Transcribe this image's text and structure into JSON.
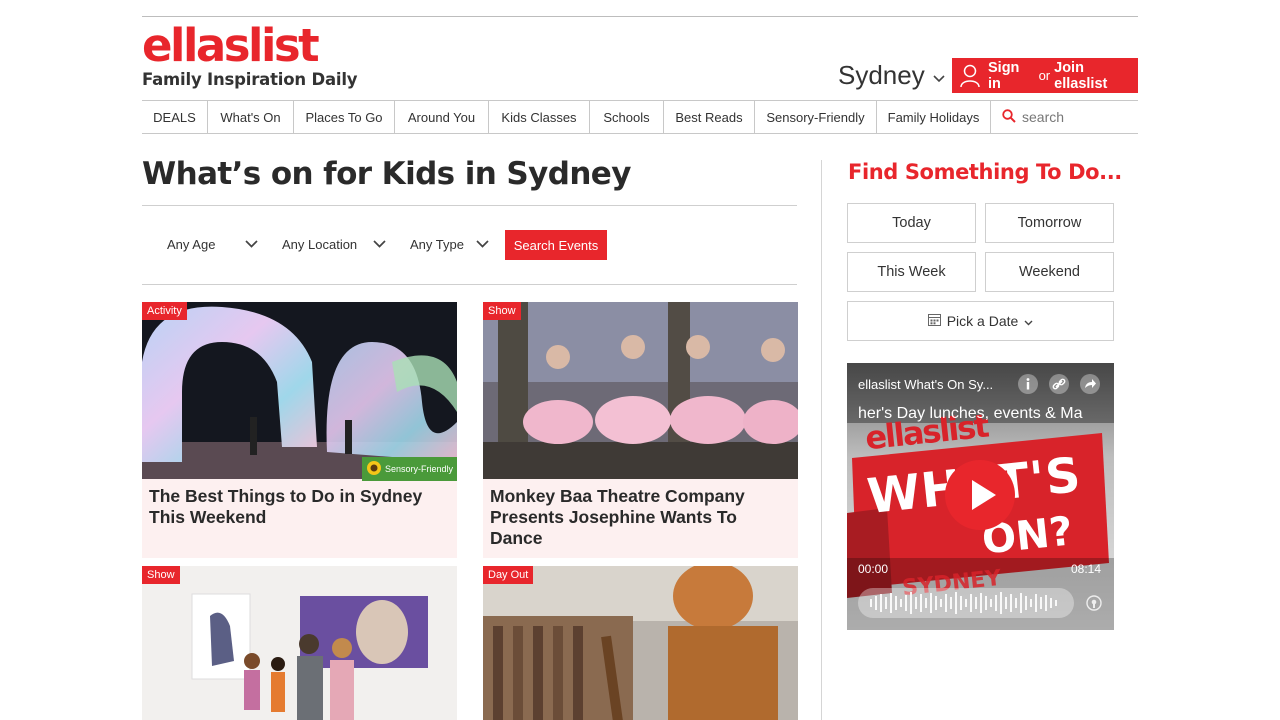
{
  "header": {
    "logo_text": "ellaslist",
    "tagline": "Family Inspiration Daily",
    "city": "Sydney",
    "signin_label": "Sign in",
    "signin_or": "or",
    "join_label": "Join ellaslist"
  },
  "nav": {
    "items": [
      "DEALS",
      "What's On",
      "Places To Go",
      "Around You",
      "Kids Classes",
      "Schools",
      "Best Reads",
      "Sensory-Friendly",
      "Family Holidays"
    ],
    "search_placeholder": "search"
  },
  "main": {
    "title": "What’s on for Kids in Sydney",
    "filters": {
      "age": "Any Age",
      "location": "Any Location",
      "type": "Any Type",
      "search_button": "Search Events"
    },
    "cards": [
      {
        "tag": "Activity",
        "title": "The Best Things to Do in Sydney This Weekend",
        "badge": "Sensory-Friendly"
      },
      {
        "tag": "Show",
        "title": "Monkey Baa Theatre Company Presents Josephine Wants To Dance"
      },
      {
        "tag": "Show",
        "title": ""
      },
      {
        "tag": "Day Out",
        "title": ""
      }
    ]
  },
  "sidebar": {
    "title": "Find Something To Do...",
    "buttons": {
      "today": "Today",
      "tomorrow": "Tomorrow",
      "this_week": "This Week",
      "weekend": "Weekend",
      "pick_date": "Pick a Date"
    },
    "video": {
      "channel": "ellaslist What's On Sy...",
      "subtitle": "her's Day lunches, events & Ma",
      "time_start": "00:00",
      "time_end": "08:14",
      "poster_brand": "ellaslist",
      "poster_line1": "WHAT'S",
      "poster_line2": "ON?",
      "poster_city": "SYDNEY"
    }
  },
  "colors": {
    "brand_red": "#e8262c",
    "sensory_green": "#4a9a3a",
    "card_bg": "#fdf0f0"
  }
}
